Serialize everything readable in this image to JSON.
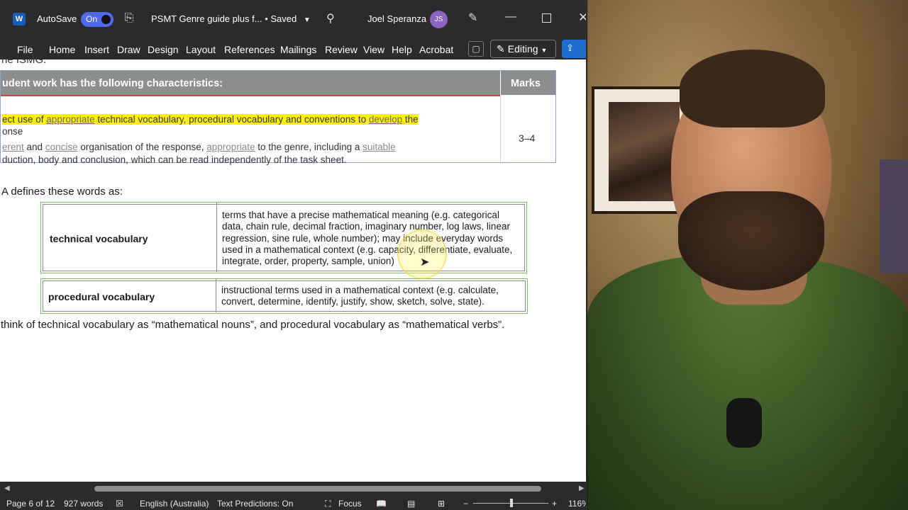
{
  "titlebar": {
    "app_icon_letter": "W",
    "autosave_label": "AutoSave",
    "autosave_state": "On",
    "doc_title": "PSMT Genre guide plus f...",
    "save_status": "• Saved",
    "user_name": "Joel Speranza",
    "user_initials": "JS"
  },
  "ribbon": {
    "tabs": [
      "File",
      "Home",
      "Insert",
      "Draw",
      "Design",
      "Layout",
      "References",
      "Mailings",
      "Review",
      "View",
      "Help",
      "Acrobat"
    ],
    "editing_label": "Editing"
  },
  "document": {
    "prev_text": "he ISMG.",
    "ismg_table": {
      "header_left": "udent work has the following characteristics:",
      "header_right": "Marks",
      "criterion_1": {
        "p1": "ect use of ",
        "w1": "appropriate",
        "p2": " technical vocabulary, procedural vocabulary and conventions to ",
        "w2": "develop",
        "p3": " the",
        "line2": "onse"
      },
      "criterion_2": {
        "w1": "erent",
        "p1": " and ",
        "w2": "concise",
        "p2": " organisation of the response, ",
        "w3": "appropriate",
        "p3": " to the genre, including a ",
        "w4": "suitable",
        "line2": "duction, body and conclusion, which can be read independently of the task sheet."
      },
      "marks": "3–4"
    },
    "defines_text": "A defines these words as:",
    "vocab": [
      {
        "term": "technical vocabulary",
        "definition": "terms that have a precise mathematical meaning (e.g. categorical data, chain rule, decimal fraction, imaginary number, log laws, linear regression, sine rule, whole number); may include everyday words used in a mathematical context (e.g. capacity, differentiate, evaluate, integrate, order, property, sample, union)"
      },
      {
        "term": "procedural vocabulary",
        "definition": "instructional terms used in a mathematical context (e.g. calculate, convert, determine, identify, justify, show, sketch, solve, state)."
      }
    ],
    "think_text": "think of technical vocabulary as “mathematical nouns”, and procedural vocabulary as “mathematical verbs”."
  },
  "statusbar": {
    "page": "Page 6 of 12",
    "words": "927 words",
    "language": "English (Australia)",
    "predictions": "Text Predictions: On",
    "focus": "Focus",
    "zoom": "116%"
  }
}
